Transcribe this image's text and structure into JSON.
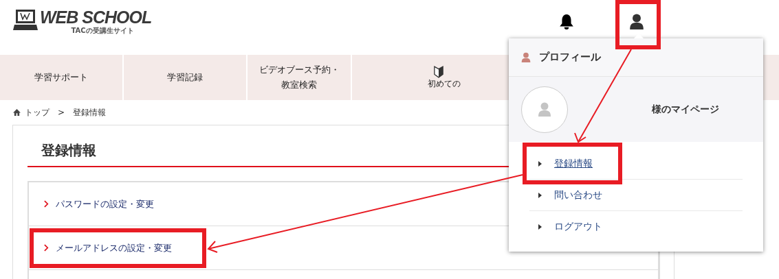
{
  "header": {
    "logo": {
      "name": "WEB SCHOOL",
      "tagline": "TACの受講生サイト"
    }
  },
  "nav": [
    {
      "lines": [
        "学習サポート"
      ]
    },
    {
      "lines": [
        "学習記録"
      ]
    },
    {
      "lines": [
        "ビデオブース予約・",
        "教室検索"
      ]
    },
    {
      "lines": [
        "初めての"
      ],
      "kind": "beginner"
    }
  ],
  "breadcrumb": {
    "home": "トップ",
    "separator": ">",
    "current": "登録情報"
  },
  "page": {
    "title": "登録情報",
    "links": [
      {
        "label": "パスワードの設定・変更"
      },
      {
        "label": "メールアドレスの設定・変更"
      }
    ]
  },
  "dropdown": {
    "title": "プロフィール",
    "greeting": "様のマイページ",
    "items": [
      {
        "label": "登録情報",
        "selected": true
      },
      {
        "label": "問い合わせ",
        "selected": false
      },
      {
        "label": "ログアウト",
        "selected": false
      }
    ]
  }
}
